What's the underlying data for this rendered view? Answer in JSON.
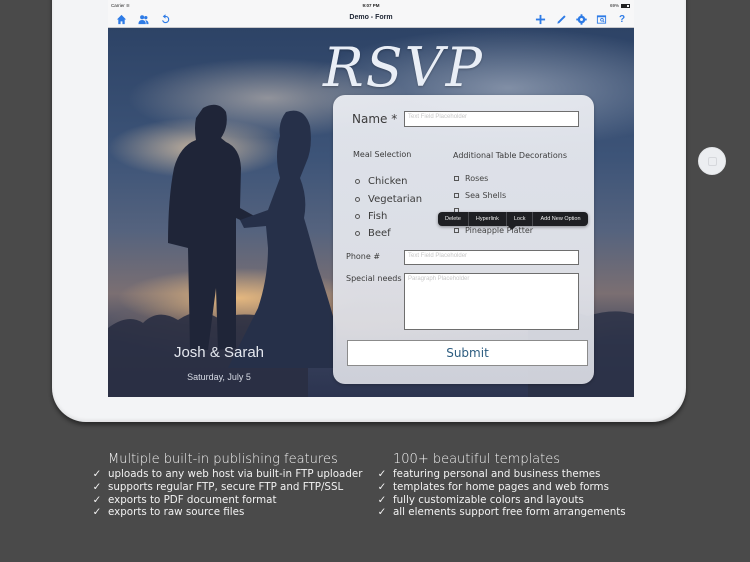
{
  "statusbar": {
    "carrier": "Carrier",
    "wifi_icon": "wifi-icon",
    "time": "9:07 PM",
    "battery_text": "69%",
    "battery_level": 0.69
  },
  "navbar": {
    "title": "Demo - Form",
    "left_icons": [
      "home-icon",
      "users-icon",
      "refresh-icon"
    ],
    "right_icons": [
      "plus-icon",
      "pencil-icon",
      "gear-icon",
      "preview-icon",
      "help-icon"
    ]
  },
  "page": {
    "heading": "RSVP",
    "couple": "Josh & Sarah",
    "date": "Saturday, July 5"
  },
  "form": {
    "name_label": "Name *",
    "name_placeholder": "Text Field Placeholder",
    "meal_label": "Meal Selection",
    "meal_options": [
      "Chicken",
      "Vegetarian",
      "Fish",
      "Beef"
    ],
    "decorations_label": "Additional Table Decorations",
    "decoration_options": [
      "Roses",
      "Sea Shells",
      "",
      "Pineapple Platter"
    ],
    "phone_label": "Phone #",
    "phone_placeholder": "Text Field Placeholder",
    "special_label": "Special needs",
    "special_placeholder": "Paragraph Placeholder",
    "submit_label": "Submit"
  },
  "context_menu": {
    "items": [
      "Delete",
      "Hyperlink",
      "Lock",
      "Add New Option"
    ]
  },
  "features_left": {
    "heading": "Multiple built-in publishing features",
    "items": [
      "uploads to any web host via built-in FTP uploader",
      "supports regular FTP, secure FTP and FTP/SSL",
      "exports to PDF document format",
      "exports to raw source files"
    ]
  },
  "features_right": {
    "heading": "100+ beautiful templates",
    "items": [
      "featuring personal and business themes",
      "templates for home pages and web forms",
      "fully customizable colors and layouts",
      "all elements support free form arrangements"
    ]
  },
  "check_glyph": "✓",
  "colors": {
    "accent": "#2e7be6",
    "background": "#4a4a4a",
    "submit_text": "#2d5d80"
  }
}
